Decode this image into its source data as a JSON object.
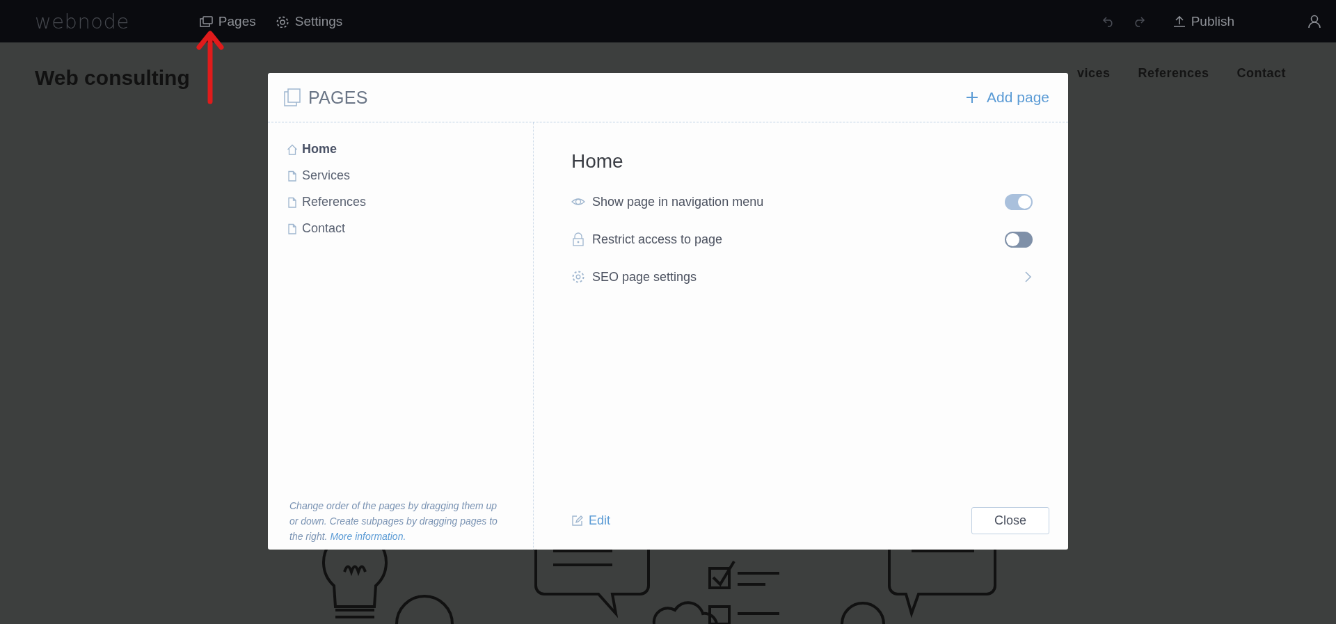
{
  "top_bar": {
    "logo": "webnode",
    "menu": [
      {
        "label": "Pages"
      },
      {
        "label": "Settings"
      }
    ],
    "publish": "Publish"
  },
  "site": {
    "title": "Web consulting",
    "nav": [
      "vices",
      "References",
      "Contact"
    ]
  },
  "dialog": {
    "title": "PAGES",
    "add_button": "Add page",
    "pages": [
      {
        "label": "Home",
        "kind": "home",
        "selected": true
      },
      {
        "label": "Services",
        "kind": "page",
        "selected": false
      },
      {
        "label": "References",
        "kind": "page",
        "selected": false
      },
      {
        "label": "Contact",
        "kind": "page",
        "selected": false
      }
    ],
    "hint": "Change order of the pages by dragging them up or down. Create subpages by dragging pages to the right.",
    "hint_link": "More information.",
    "page_title": "Home",
    "options": [
      {
        "kind": "toggle",
        "label": "Show page in navigation menu",
        "on": true
      },
      {
        "kind": "toggle",
        "label": "Restrict access to page",
        "on": false
      },
      {
        "kind": "link",
        "label": "SEO page settings"
      }
    ],
    "edit": "Edit",
    "close": "Close"
  }
}
